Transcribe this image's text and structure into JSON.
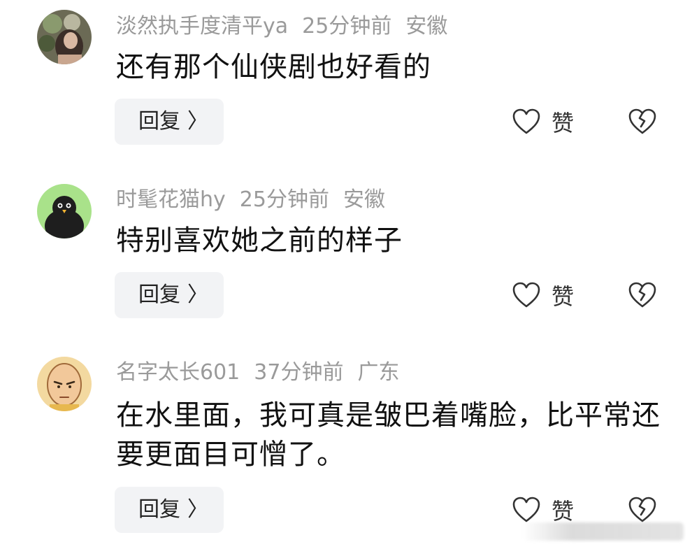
{
  "comments": [
    {
      "username": "淡然执手度清平ya",
      "time": "25分钟前",
      "location": "安徽",
      "text": "还有那个仙侠剧也好看的",
      "reply_label": "回复",
      "like_label": "赞"
    },
    {
      "username": "时髦花猫hy",
      "time": "25分钟前",
      "location": "安徽",
      "text": "特别喜欢她之前的样子",
      "reply_label": "回复",
      "like_label": "赞"
    },
    {
      "username": "名字太长601",
      "time": "37分钟前",
      "location": "广东",
      "text": "在水里面，我可真是皱巴着嘴脸，比平常还要更面目可憎了。",
      "reply_label": "回复",
      "like_label": "赞"
    }
  ],
  "icons": {
    "reply_chevron": "chevron-right-icon",
    "like": "heart-outline-icon",
    "dislike": "broken-heart-icon"
  },
  "colors": {
    "meta_text": "#9a9a9a",
    "body_text": "#111111",
    "reply_bg": "#f2f3f5"
  }
}
